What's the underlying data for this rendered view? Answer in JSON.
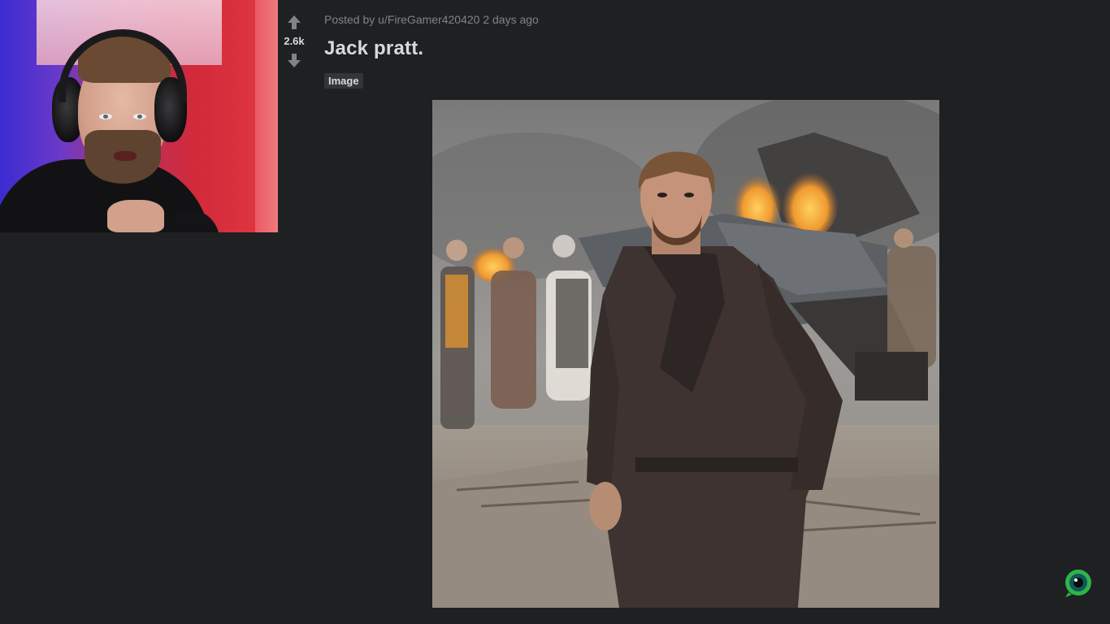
{
  "post": {
    "vote_count": "2.6k",
    "posted_by_prefix": "Posted by",
    "author": "u/FireGamer420420",
    "age": "2 days ago",
    "title": "Jack pratt.",
    "flair": "Image"
  },
  "icons": {
    "upvote": "arrow-up-icon",
    "downvote": "arrow-down-icon",
    "channel_logo": "green-eye-logo"
  },
  "colors": {
    "background": "#1f2021",
    "text_primary": "#d7dadc",
    "text_meta": "#818384",
    "flair_bg": "#343536",
    "logo_green": "#2fb34a"
  }
}
